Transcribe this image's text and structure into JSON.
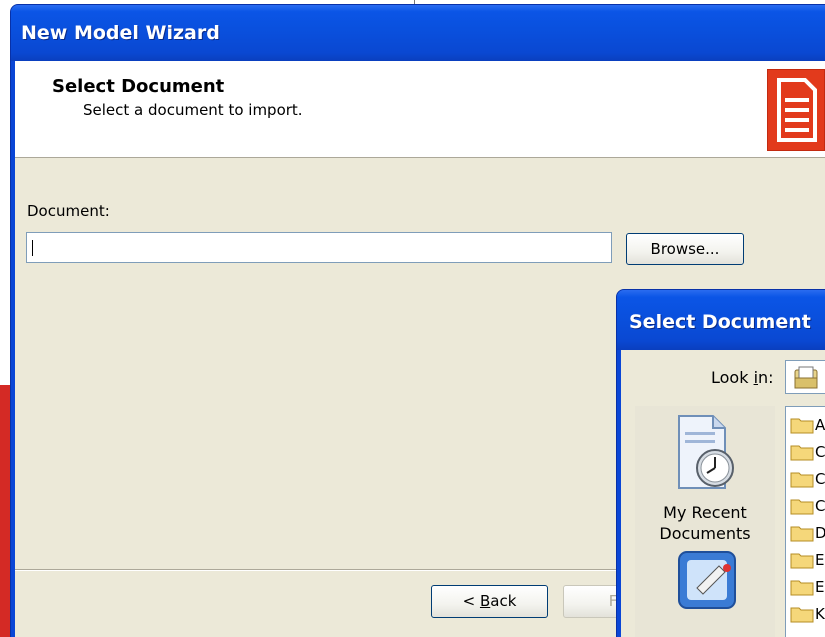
{
  "wizard": {
    "title": "New Model Wizard",
    "header_title": "Select Document",
    "header_subtitle": "Select a document to import.",
    "document_label": "Document:",
    "document_value": "",
    "browse_label": "Browse...",
    "back_label": "< Back",
    "finish_label": "Fini"
  },
  "dialog": {
    "title": "Select Document",
    "lookin_label": "Look in:",
    "places": [
      {
        "label_line1": "My Recent",
        "label_line2": "Documents",
        "icon": "recent-documents-icon"
      },
      {
        "label": "",
        "icon": "desktop-icon"
      }
    ],
    "files": [
      "A",
      "C",
      "C",
      "C",
      "D",
      "E",
      "E",
      "K"
    ]
  },
  "colors": {
    "titlebar": "#0a4fdc",
    "face": "#ece9d8",
    "doc_icon": "#e23a1c"
  }
}
